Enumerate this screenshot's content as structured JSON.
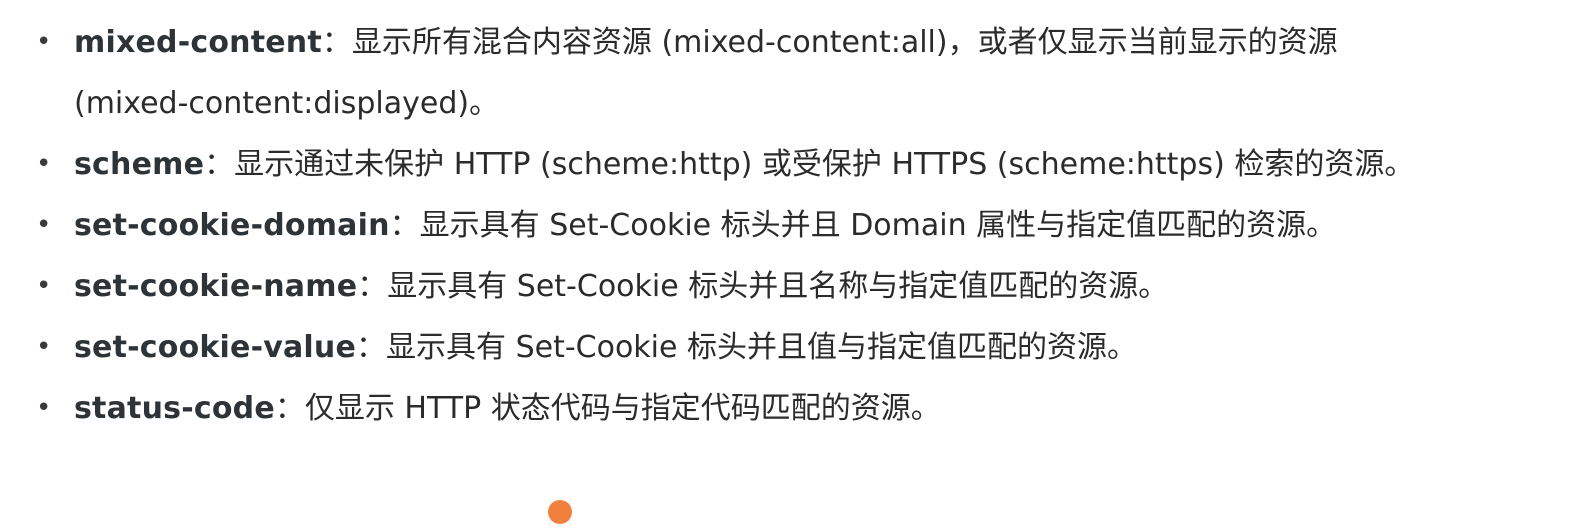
{
  "items": [
    {
      "term": "mixed-content",
      "desc": "：显示所有混合内容资源 (mixed-content:all)，或者仅显示当前显示的资源 (mixed-content:displayed)。"
    },
    {
      "term": "scheme",
      "desc": "：显示通过未保护 HTTP (scheme:http) 或受保护 HTTPS (scheme:https) 检索的资源。"
    },
    {
      "term": "set-cookie-domain",
      "desc": "：显示具有 Set-Cookie 标头并且 Domain 属性与指定值匹配的资源。"
    },
    {
      "term": "set-cookie-name",
      "desc": "：显示具有 Set-Cookie 标头并且名称与指定值匹配的资源。"
    },
    {
      "term": "set-cookie-value",
      "desc": "：显示具有 Set-Cookie 标头并且值与指定值匹配的资源。"
    },
    {
      "term": "status-code",
      "desc": "：仅显示 HTTP 状态代码与指定代码匹配的资源。"
    }
  ],
  "colors": {
    "text": "#2b2b2b",
    "term": "#2e3338",
    "accent": "#f0803c"
  }
}
